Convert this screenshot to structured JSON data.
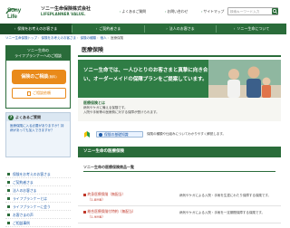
{
  "header": {
    "logo_mark": "Sony Life",
    "company_jp": "ソニー生命保険株式会社",
    "company_en": "LIFEPLANNER VALUE.",
    "links": [
      "よくあるご質問",
      "お問い合わせ",
      "サイトマップ"
    ],
    "search_placeholder": "検索キーワード入力"
  },
  "nav": {
    "items": [
      {
        "label": "保険をお考えのお客さま",
        "active": true
      },
      {
        "label": "ご契約者さま",
        "active": false
      },
      {
        "label": "法人のお客さま",
        "active": false
      },
      {
        "label": "ソニー生命について",
        "active": false
      }
    ]
  },
  "breadcrumb": [
    "ソニー生命保険トップ",
    "保険をお考えのお客さま",
    "保険の種類",
    "個人",
    "医療保険"
  ],
  "sidebar": {
    "box_title_1": "ソニー生命の",
    "box_title_2": "ライフプランナーへのご相談",
    "box_sub": "",
    "cta_label": "保険のご相談",
    "cta_sub": "(無料)",
    "request_label": "ご相談依頼",
    "faq_title": "よくあるご質問",
    "faq_text": "医療保険に入る必要がありますか？持病があっても加入できますか？",
    "links": [
      "保険をお考えのお客さま",
      "ご契約者さま",
      "法人のお客さま",
      "ライフプランナーとは",
      "ライフプランナーに会う",
      "お客さまの声",
      "ご相談事例"
    ]
  },
  "main": {
    "page_title": "医療保険",
    "hero_text": "ソニー生命では、一人ひとりのお客さまと真摯に向き合い、オーダーメイドの保障プランをご提案しています。",
    "note_title": "医療保険とは",
    "note_line1": "病気やケガに備える保険です。",
    "note_line2": "入院や手術等の医療費に対する保障が受けられます。",
    "basic_button": "保険の基礎知識",
    "basic_desc": "保険の種類や仕組みについてわかりやすく解説します。",
    "section_title": "ソニー生命の医療保険",
    "section_sub": "ソニー生命の医療保険商品一覧",
    "products": [
      {
        "name": "終身医療保険（無配当）",
        "sub": "（1.8MB）",
        "desc": "病気やケガによる入院・手術を生涯にわたり保障する保険です。"
      },
      {
        "name": "総合医療保険付特約（無配当）",
        "sub": "（1.9MB）",
        "desc": "病気やケガによる入院・手術を一定期間保障する保険です。"
      }
    ]
  },
  "colors": {
    "brand_green": "#2a6c3a",
    "cta_orange": "#e98a1a",
    "link_blue": "#1e5aa8",
    "product_red": "#c0392b"
  }
}
